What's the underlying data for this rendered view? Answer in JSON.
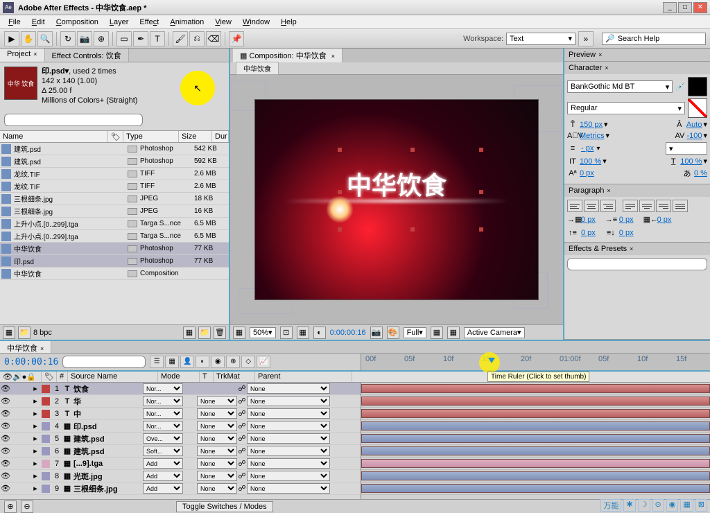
{
  "title": "Adobe After Effects - 中华饮食.aep *",
  "menu": [
    "File",
    "Edit",
    "Composition",
    "Layer",
    "Effect",
    "Animation",
    "View",
    "Window",
    "Help"
  ],
  "workspace": {
    "label": "Workspace:",
    "value": "Text"
  },
  "search_help": "Search Help",
  "project": {
    "tab1": "Project",
    "tab2": "Effect Controls: 饮食",
    "item_name": "印.psd▾",
    "used": ", used 2 times",
    "dims": "142 x 140 (1.00)",
    "delta": "Δ 25.00 f",
    "colors": "Millions of Colors+ (Straight)",
    "thumb_text": "中华\n饮食",
    "cols": {
      "name": "Name",
      "type": "Type",
      "size": "Size",
      "dur": "Dur"
    },
    "rows": [
      {
        "name": "建筑.psd",
        "type": "Photoshop",
        "size": "542 KB",
        "sel": false
      },
      {
        "name": "建筑.psd",
        "type": "Photoshop",
        "size": "592 KB",
        "sel": false
      },
      {
        "name": "龙纹.TIF",
        "type": "TIFF",
        "size": "2.6 MB",
        "sel": false
      },
      {
        "name": "龙纹.TIF",
        "type": "TIFF",
        "size": "2.6 MB",
        "sel": false
      },
      {
        "name": "三根细条.jpg",
        "type": "JPEG",
        "size": "18 KB",
        "sel": false
      },
      {
        "name": "三根细条.jpg",
        "type": "JPEG",
        "size": "16 KB",
        "sel": false
      },
      {
        "name": "上升小点.[0..299].tga",
        "type": "Targa S...nce",
        "size": "6.5 MB",
        "sel": false
      },
      {
        "name": "上升小点.[0..299].tga",
        "type": "Targa S...nce",
        "size": "6.5 MB",
        "sel": false
      },
      {
        "name": "中华饮食",
        "type": "Photoshop",
        "size": "77 KB",
        "sel": true
      },
      {
        "name": "印.psd",
        "type": "Photoshop",
        "size": "77 KB",
        "sel": true
      },
      {
        "name": "中华饮食",
        "type": "Composition",
        "size": "",
        "sel": false
      }
    ],
    "bpc": "8 bpc"
  },
  "comp": {
    "tab": "Composition: 中华饮食",
    "crumb": "中华饮食",
    "text": "中华饮食",
    "zoom": "50%",
    "res": "Full",
    "time": "0:00:00:16",
    "camera": "Active Camera"
  },
  "preview": {
    "title": "Preview"
  },
  "character": {
    "title": "Character",
    "font": "BankGothic Md BT",
    "style": "Regular",
    "size": "150 px",
    "leading": "Auto",
    "kerning": "Metrics",
    "tracking": "-100",
    "stroke_w": "- px",
    "vscale": "100 %",
    "hscale": "100 %",
    "baseline": "0 px",
    "tsume": "0 %"
  },
  "paragraph": {
    "title": "Paragraph",
    "indent_l": "0 px",
    "indent_r": "0 px",
    "first": "0 px",
    "before": "0 px",
    "after": "0 px"
  },
  "effects": {
    "title": "Effects & Presets"
  },
  "timeline": {
    "tab": "中华饮食",
    "time": "0:00:00:16",
    "cols": {
      "source": "Source Name",
      "mode": "Mode",
      "t": "T",
      "trkmat": "TrkMat",
      "parent": "Parent"
    },
    "ruler": [
      "00f",
      "05f",
      "10f",
      "15f",
      "20f",
      "01:00f",
      "05f",
      "10f",
      "15f"
    ],
    "tooltip": "Time Ruler (Click to set thumb)",
    "layers": [
      {
        "n": 1,
        "name": "饮食",
        "icon": "T",
        "lbl": "#c04040",
        "mode": "Nor...",
        "trk": "",
        "par": "None",
        "sel": true
      },
      {
        "n": 2,
        "name": "华",
        "icon": "T",
        "lbl": "#c04040",
        "mode": "Nor...",
        "trk": "None",
        "par": "None"
      },
      {
        "n": 3,
        "name": "中",
        "icon": "T",
        "lbl": "#c04040",
        "mode": "Nor...",
        "trk": "None",
        "par": "None"
      },
      {
        "n": 4,
        "name": "印.psd",
        "icon": "▦",
        "lbl": "#9898c0",
        "mode": "Nor...",
        "trk": "None",
        "par": "None"
      },
      {
        "n": 5,
        "name": "建筑.psd",
        "icon": "▦",
        "lbl": "#9898c0",
        "mode": "Ove...",
        "trk": "None",
        "par": "None"
      },
      {
        "n": 6,
        "name": "建筑.psd",
        "icon": "▦",
        "lbl": "#9898c0",
        "mode": "Soft...",
        "trk": "None",
        "par": "None"
      },
      {
        "n": 7,
        "name": "[...9].tga",
        "icon": "▦",
        "lbl": "#d8a8c0",
        "mode": "Add",
        "trk": "None",
        "par": "None"
      },
      {
        "n": 8,
        "name": "光斑.jpg",
        "icon": "▦",
        "lbl": "#9898c0",
        "mode": "Add",
        "trk": "None",
        "par": "None"
      },
      {
        "n": 9,
        "name": "三根细条.jpg",
        "icon": "▦",
        "lbl": "#9898c0",
        "mode": "Add",
        "trk": "None",
        "par": "None"
      }
    ],
    "toggle": "Toggle Switches / Modes"
  },
  "statusbar": [
    "万能",
    "✱",
    "☽",
    "⊙",
    "◉",
    "▦",
    "⊠"
  ]
}
